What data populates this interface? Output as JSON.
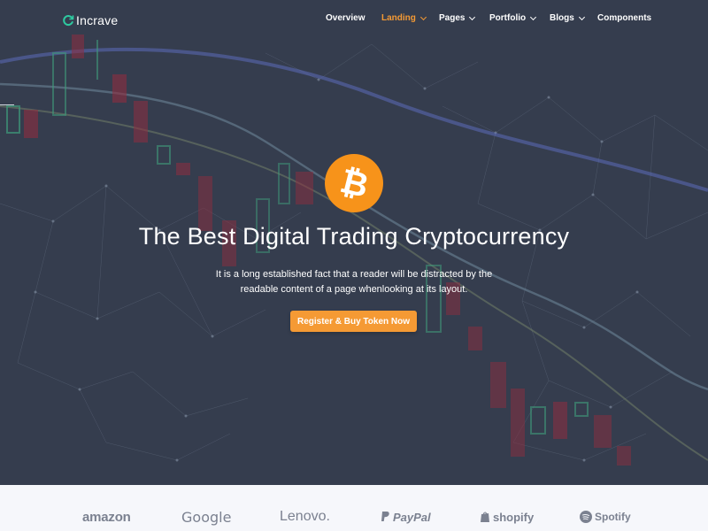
{
  "brand": {
    "name": "Incrave",
    "accent": "#f59a34",
    "logo_color": "#2ec9a0"
  },
  "nav": {
    "items": [
      {
        "label": "Overview",
        "active": false,
        "dropdown": false
      },
      {
        "label": "Landing",
        "active": true,
        "dropdown": true
      },
      {
        "label": "Pages",
        "active": false,
        "dropdown": true
      },
      {
        "label": "Portfolio",
        "active": false,
        "dropdown": true
      },
      {
        "label": "Blogs",
        "active": false,
        "dropdown": true
      },
      {
        "label": "Components",
        "active": false,
        "dropdown": false
      }
    ]
  },
  "hero": {
    "icon": "bitcoin-icon",
    "icon_glyph": "₿",
    "title": "The Best Digital Trading Cryptocurrency",
    "text_line1": "It is a long established fact that a reader will be distracted by the",
    "text_line2": "readable content of a page whenlooking at its layout.",
    "cta_label": "Register & Buy Token Now",
    "background_color": "#353d4e"
  },
  "clients": {
    "logos": [
      "amazon",
      "Google",
      "Lenovo.",
      "PayPal",
      "shopify",
      "Spotify"
    ]
  }
}
